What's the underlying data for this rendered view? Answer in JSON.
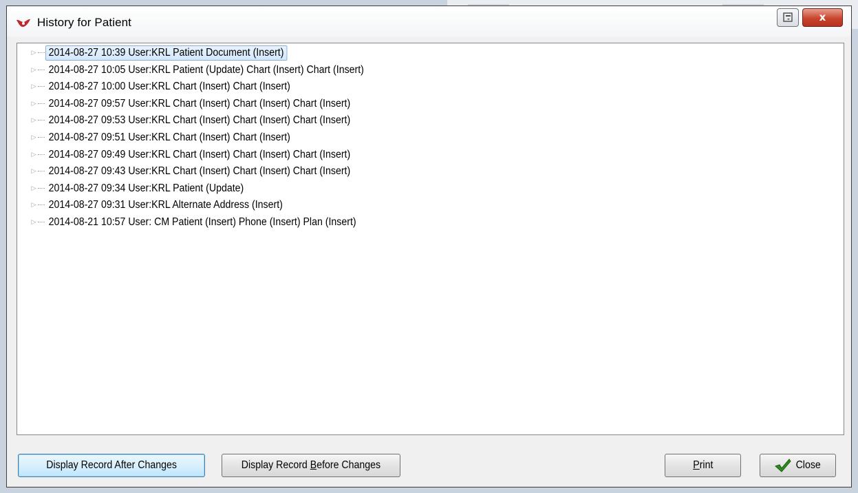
{
  "window": {
    "title": "History for Patient",
    "close_glyph": "x"
  },
  "colors": {
    "selection_border": "#84acdd",
    "focused_button_border": "#3c7fb1",
    "close_button_red": "#c9442d",
    "check_green": "#2e8b1e"
  },
  "icons": {
    "title": "app-logo-icon",
    "restore": "restore-icon",
    "close": "close-icon",
    "expander": "expand-arrow-icon",
    "close_button": "checkmark-icon"
  },
  "history": [
    {
      "text": "2014-08-27 10:39 User:KRL  Patient Document (Insert)",
      "selected": true
    },
    {
      "text": "2014-08-27 10:05 User:KRL  Patient (Update) Chart (Insert) Chart (Insert)"
    },
    {
      "text": "2014-08-27 10:00 User:KRL  Chart (Insert) Chart (Insert)"
    },
    {
      "text": "2014-08-27 09:57 User:KRL  Chart (Insert) Chart (Insert) Chart (Insert)"
    },
    {
      "text": "2014-08-27 09:53 User:KRL  Chart (Insert) Chart (Insert) Chart (Insert)"
    },
    {
      "text": "2014-08-27 09:51 User:KRL  Chart (Insert) Chart (Insert)"
    },
    {
      "text": "2014-08-27 09:49 User:KRL  Chart (Insert) Chart (Insert) Chart (Insert)"
    },
    {
      "text": "2014-08-27 09:43 User:KRL  Chart (Insert) Chart (Insert) Chart (Insert)"
    },
    {
      "text": "2014-08-27 09:34 User:KRL  Patient (Update)"
    },
    {
      "text": "2014-08-27 09:31 User:KRL  Alternate Address (Insert)"
    },
    {
      "text": "2014-08-21 10:57 User: CM  Patient (Insert) Phone (Insert) Plan (Insert)"
    }
  ],
  "buttons": {
    "display_after": "Display Record After Changes",
    "display_before_prefix": "Display Record ",
    "display_before_accel": "B",
    "display_before_suffix": "efore Changes",
    "print_accel": "P",
    "print_rest": "rint",
    "close": "Close"
  }
}
